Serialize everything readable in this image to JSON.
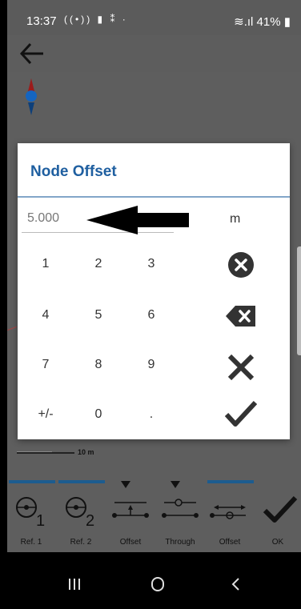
{
  "status": {
    "time": "13:37",
    "left_icons": "((•)) ▮ ⁑ ·",
    "battery": "41%"
  },
  "map": {
    "scale_label": "10 m"
  },
  "dialog": {
    "title": "Node Offset",
    "value": "5.000",
    "unit": "m",
    "keys": [
      "1",
      "2",
      "3",
      "4",
      "5",
      "6",
      "7",
      "8",
      "9",
      "+/-",
      "0",
      "."
    ]
  },
  "toolbar": {
    "items": [
      {
        "label": "Ref. 1"
      },
      {
        "label": "Ref. 2"
      },
      {
        "label": "Offset"
      },
      {
        "label": "Through"
      },
      {
        "label": "Offset"
      },
      {
        "label": "OK"
      }
    ]
  },
  "colors": {
    "accent": "#1f5fa0",
    "dim": "#5e5e5e"
  }
}
